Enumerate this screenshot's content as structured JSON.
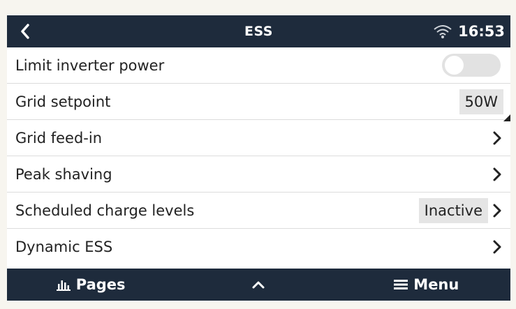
{
  "header": {
    "title": "ESS",
    "time": "16:53",
    "back_icon": "chevron-left-icon",
    "wifi_icon": "wifi-icon"
  },
  "rows": [
    {
      "label": "Limit inverter power",
      "control": "toggle",
      "toggle_on": false
    },
    {
      "label": "Grid setpoint",
      "control": "value",
      "value": "50W"
    },
    {
      "label": "Grid feed-in",
      "control": "chevron"
    },
    {
      "label": "Peak shaving",
      "control": "chevron"
    },
    {
      "label": "Scheduled charge levels",
      "control": "value-chevron",
      "value": "Inactive"
    },
    {
      "label": "Dynamic ESS",
      "control": "chevron"
    }
  ],
  "footer": {
    "pages_label": "Pages",
    "menu_label": "Menu",
    "pages_icon": "bar-chart-icon",
    "up_icon": "chevron-up-icon",
    "menu_icon": "hamburger-icon"
  },
  "colors": {
    "bar_bg": "#1e2b3c",
    "toggle_off": "#e2e2e2",
    "value_bg": "#e5e5e5"
  }
}
